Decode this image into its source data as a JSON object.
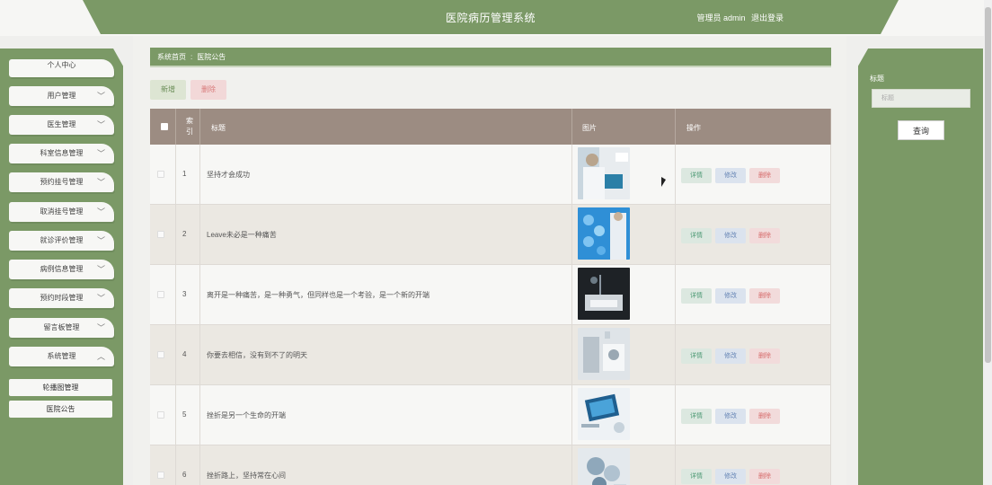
{
  "header": {
    "title": "医院病历管理系统",
    "user": "管理员 admin",
    "logout": "退出登录"
  },
  "sidebar": {
    "items": [
      {
        "label": "个人中心"
      },
      {
        "label": "用户管理"
      },
      {
        "label": "医生管理"
      },
      {
        "label": "科室信息管理"
      },
      {
        "label": "预约挂号管理"
      },
      {
        "label": "取消挂号管理"
      },
      {
        "label": "就诊评价管理"
      },
      {
        "label": "病例信息管理"
      },
      {
        "label": "预约时段管理"
      },
      {
        "label": "留言板管理"
      },
      {
        "label": "系统管理"
      }
    ],
    "sub_items": [
      {
        "label": "轮播图管理"
      },
      {
        "label": "医院公告"
      }
    ]
  },
  "breadcrumb": {
    "home": "系统首页",
    "sep": ":",
    "current": "医院公告"
  },
  "toolbar": {
    "add_label": "新增",
    "delete_label": "删除"
  },
  "table": {
    "headers": {
      "index": "索引",
      "title": "标题",
      "image": "图片",
      "actions": "操作"
    },
    "rows": [
      {
        "index": "1",
        "title": "坚持才会成功"
      },
      {
        "index": "2",
        "title": "Leave未必是一种痛苦"
      },
      {
        "index": "3",
        "title": "离开是一种痛苦，是一种勇气，但同样也是一个考验，是一个新的开端"
      },
      {
        "index": "4",
        "title": "你要去相信，没有到不了的明天"
      },
      {
        "index": "5",
        "title": "挫折是另一个生命的开端"
      },
      {
        "index": "6",
        "title": "挫折路上，坚持常在心间"
      }
    ],
    "action_labels": {
      "detail": "详情",
      "edit": "修改",
      "delete": "删除"
    }
  },
  "search_panel": {
    "label": "标题",
    "placeholder": "标题",
    "button": "查询"
  },
  "colors": {
    "accent": "#7b9966",
    "table_header": "#9c8c82"
  }
}
